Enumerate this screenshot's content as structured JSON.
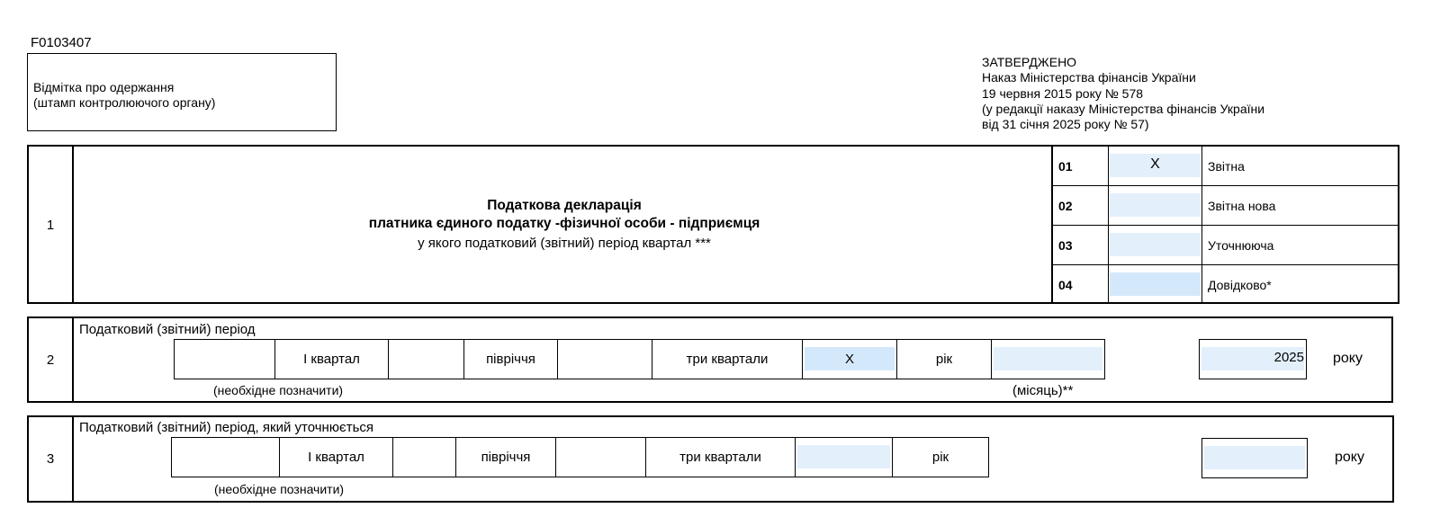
{
  "form_code": "F0103407",
  "stamp": {
    "line1": "Відмітка про одержання",
    "line2": "(штамп контролюючого органу)"
  },
  "approved": {
    "line1": "ЗАТВЕРДЖЕНО",
    "line2": "Наказ Міністерства фінансів України",
    "line3": "19 червня 2015 року № 578",
    "line4": "(у редакції наказу Міністерства фінансів України",
    "line5": "від 31 січня 2025 року № 57)"
  },
  "section1": {
    "number": "1",
    "title_line1": "Податкова декларація",
    "title_line2": "платника єдиного податку -фізичної особи - підприємця",
    "title_line3": "у якого податковий (звітний) період квартал ***",
    "types": [
      {
        "code": "01",
        "value": "X",
        "label": "Звітна"
      },
      {
        "code": "02",
        "value": "",
        "label": "Звітна нова"
      },
      {
        "code": "03",
        "value": "",
        "label": "Уточнююча"
      },
      {
        "code": "04",
        "value": "",
        "label": "Довідково*"
      }
    ]
  },
  "section2": {
    "number": "2",
    "heading": "Податковий (звітний) період",
    "q1_label": "І квартал",
    "q1_value": "",
    "half_label": "півріччя",
    "half_value": "",
    "three_q_label": "три квартали",
    "three_q_value": "X",
    "year_label": "рік",
    "year_value": "",
    "year_number": "2025",
    "year_suffix": "року",
    "note_mark": "(необхідне позначити)",
    "note_month": "(місяць)**"
  },
  "section3": {
    "number": "3",
    "heading": "Податковий (звітний) період, який уточнюється",
    "q1_label": "І квартал",
    "q1_value": "",
    "half_label": "півріччя",
    "half_value": "",
    "three_q_label": "три квартали",
    "three_q_value": "",
    "year_label": "рік",
    "year_number": "",
    "year_suffix": "року",
    "note_mark": "(необхідне позначити)"
  }
}
